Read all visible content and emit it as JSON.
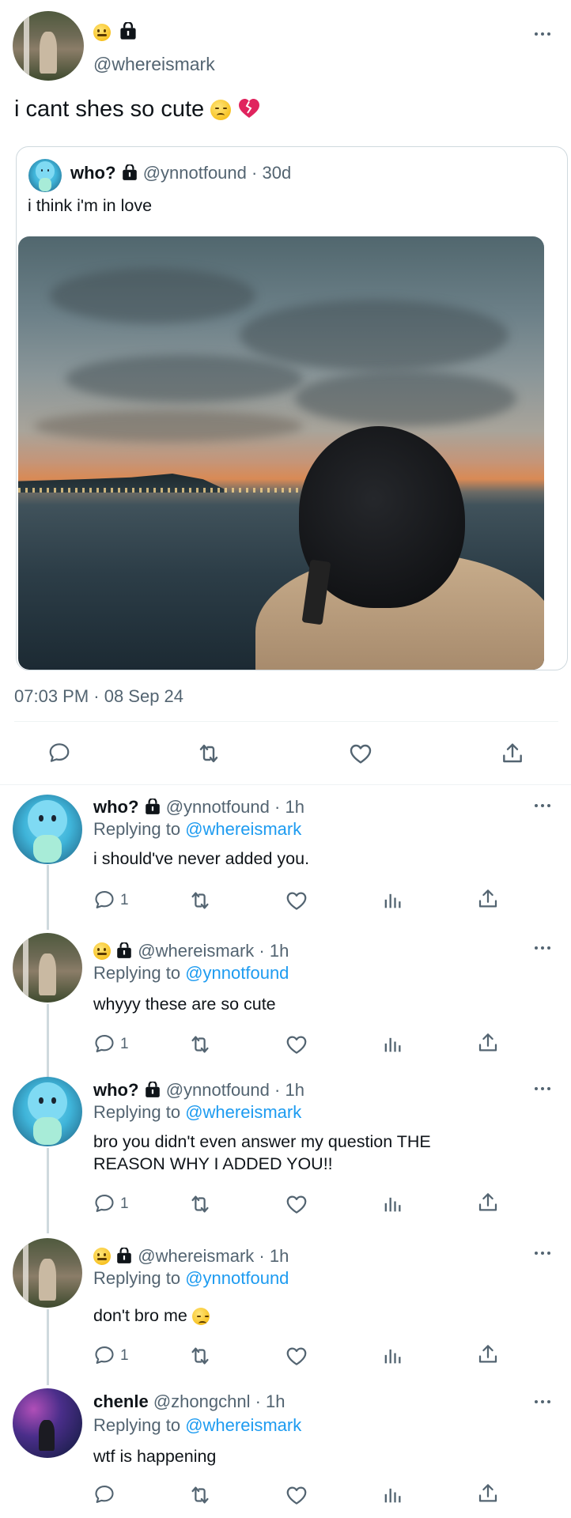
{
  "main_post": {
    "handle": "@whereismark",
    "text": "i cant shes so cute",
    "timestamp": "07:03 PM · 08 Sep 24"
  },
  "quoted_post": {
    "name": "who?",
    "handle": "@ynnotfound",
    "age": "· 30d",
    "text": "i think i'm in love"
  },
  "replies": [
    {
      "name": "who?",
      "handle": "@ynnotfound",
      "age": "· 1h",
      "replying_prefix": "Replying to",
      "replying_to": "@whereismark",
      "text": "i should've never added you.",
      "reply_count": "1"
    },
    {
      "name": "",
      "handle": "@whereismark",
      "age": "· 1h",
      "replying_prefix": "Replying to",
      "replying_to": "@ynnotfound",
      "text": "whyyy these are so cute",
      "reply_count": "1"
    },
    {
      "name": "who?",
      "handle": "@ynnotfound",
      "age": "· 1h",
      "replying_prefix": "Replying to",
      "replying_to": "@whereismark",
      "text_line1": "bro you didn't even answer my question THE",
      "text_line2": "REASON WHY I ADDED YOU!!",
      "reply_count": "1"
    },
    {
      "name": "",
      "handle": "@whereismark",
      "age": "· 1h",
      "replying_prefix": "Replying to",
      "replying_to": "@ynnotfound",
      "text": "don't bro me",
      "reply_count": "1"
    },
    {
      "name": "chenle",
      "handle": "@zhongchnl",
      "age": "· 1h",
      "replying_prefix": "Replying to",
      "replying_to": "@whereismark",
      "text": "wtf is happening",
      "reply_count": ""
    }
  ],
  "icons": {
    "more": "more-dots-icon",
    "reply": "reply-bubble-icon",
    "retweet": "retweet-icon",
    "like": "heart-icon",
    "views": "views-bar-icon",
    "share": "share-upload-icon",
    "lock": "lock-icon"
  },
  "colors": {
    "link": "#1d9bf0",
    "secondary_text": "#536471",
    "primary_text": "#0f1419",
    "border": "#cfd9de"
  }
}
